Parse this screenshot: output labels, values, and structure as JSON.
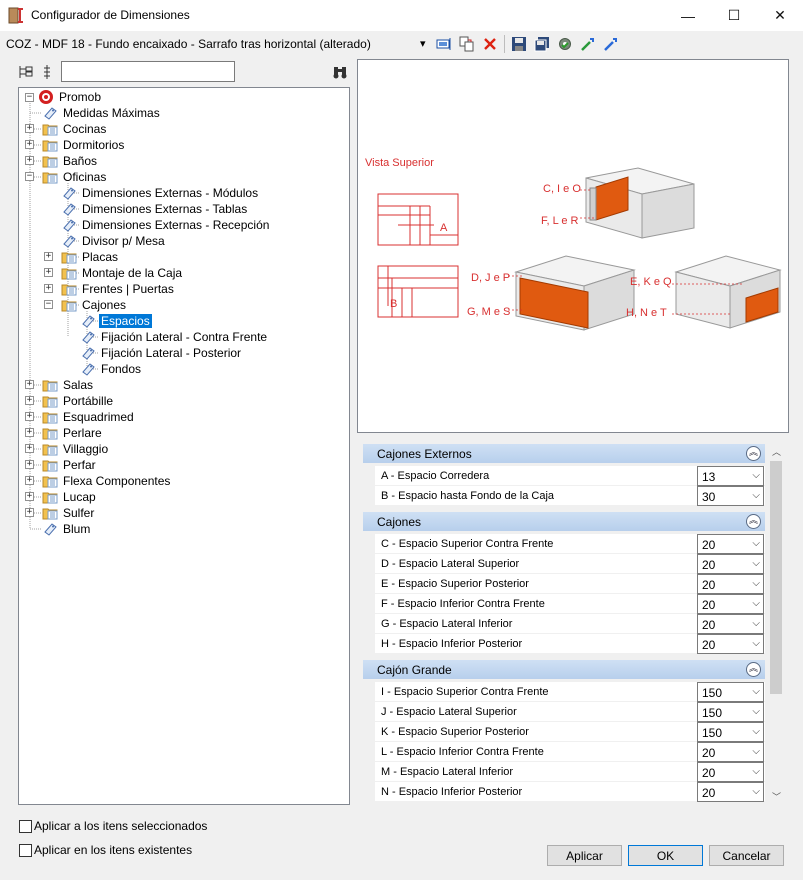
{
  "window": {
    "title": "Configurador de Dimensiones",
    "minimize_glyph": "—",
    "maximize_glyph": "☐",
    "close_glyph": "✕"
  },
  "toolbar": {
    "item_combo": "COZ - MDF 18 - Fundo encaixado - Sarrafo tras horizontal (alterado)",
    "combo_arrow": "▾"
  },
  "search": {
    "value": "",
    "placeholder": ""
  },
  "tree": {
    "root": "Promob",
    "items": [
      {
        "label": "Medidas Máximas"
      },
      {
        "label": "Cocinas"
      },
      {
        "label": "Dormitorios"
      },
      {
        "label": "Baños"
      },
      {
        "label": "Oficinas"
      },
      {
        "label": "Dimensiones Externas - Módulos"
      },
      {
        "label": "Dimensiones Externas - Tablas"
      },
      {
        "label": "Dimensiones Externas - Recepción"
      },
      {
        "label": "Divisor p/ Mesa"
      },
      {
        "label": "Placas"
      },
      {
        "label": "Montaje de la Caja"
      },
      {
        "label": "Frentes | Puertas"
      },
      {
        "label": "Cajones"
      },
      {
        "label": "Espacios"
      },
      {
        "label": "Fijación Lateral - Contra Frente"
      },
      {
        "label": "Fijación Lateral - Posterior"
      },
      {
        "label": "Fondos"
      },
      {
        "label": "Salas"
      },
      {
        "label": "Portábille"
      },
      {
        "label": "Esquadrimed"
      },
      {
        "label": "Perlare"
      },
      {
        "label": "Villaggio"
      },
      {
        "label": "Perfar"
      },
      {
        "label": "Flexa Componentes"
      },
      {
        "label": "Lucap"
      },
      {
        "label": "Sulfer"
      },
      {
        "label": "Blum"
      }
    ]
  },
  "preview": {
    "title": "Vista Superior",
    "label_a": "A",
    "label_b": "B",
    "label_cio": "C, I e O",
    "label_flr": "F, L e R",
    "label_djp": "D, J e P",
    "label_gms": "G, M e S",
    "label_ekq": "E, K e Q",
    "label_hnt": "H, N e T"
  },
  "groups": [
    {
      "title": "Cajones Externos",
      "rows": [
        {
          "name": "A - Espacio Corredera",
          "value": "13"
        },
        {
          "name": "B - Espacio hasta Fondo de la Caja",
          "value": "30"
        }
      ]
    },
    {
      "title": "Cajones",
      "rows": [
        {
          "name": "C - Espacio Superior Contra Frente",
          "value": "20"
        },
        {
          "name": "D - Espacio Lateral Superior",
          "value": "20"
        },
        {
          "name": "E - Espacio Superior Posterior",
          "value": "20"
        },
        {
          "name": "F - Espacio Inferior Contra Frente",
          "value": "20"
        },
        {
          "name": "G - Espacio Lateral Inferior",
          "value": "20"
        },
        {
          "name": "H - Espacio Inferior Posterior",
          "value": "20"
        }
      ]
    },
    {
      "title": "Cajón Grande",
      "rows": [
        {
          "name": "I - Espacio Superior Contra Frente",
          "value": "150"
        },
        {
          "name": "J - Espacio Lateral Superior",
          "value": "150"
        },
        {
          "name": "K - Espacio Superior Posterior",
          "value": "150"
        },
        {
          "name": "L - Espacio Inferior Contra Frente",
          "value": "20"
        },
        {
          "name": "M - Espacio Lateral Inferior",
          "value": "20"
        },
        {
          "name": "N - Espacio Inferior Posterior",
          "value": "20"
        }
      ]
    }
  ],
  "options": {
    "apply_selected": "Aplicar a los itens seleccionados",
    "apply_existing": "Aplicar en los itens existentes"
  },
  "buttons": {
    "apply": "Aplicar",
    "ok": "OK",
    "cancel": "Cancelar"
  },
  "colors": {
    "accent": "#0078d7",
    "drawer_orange": "#e05a10",
    "annotation_red": "#d83030"
  }
}
